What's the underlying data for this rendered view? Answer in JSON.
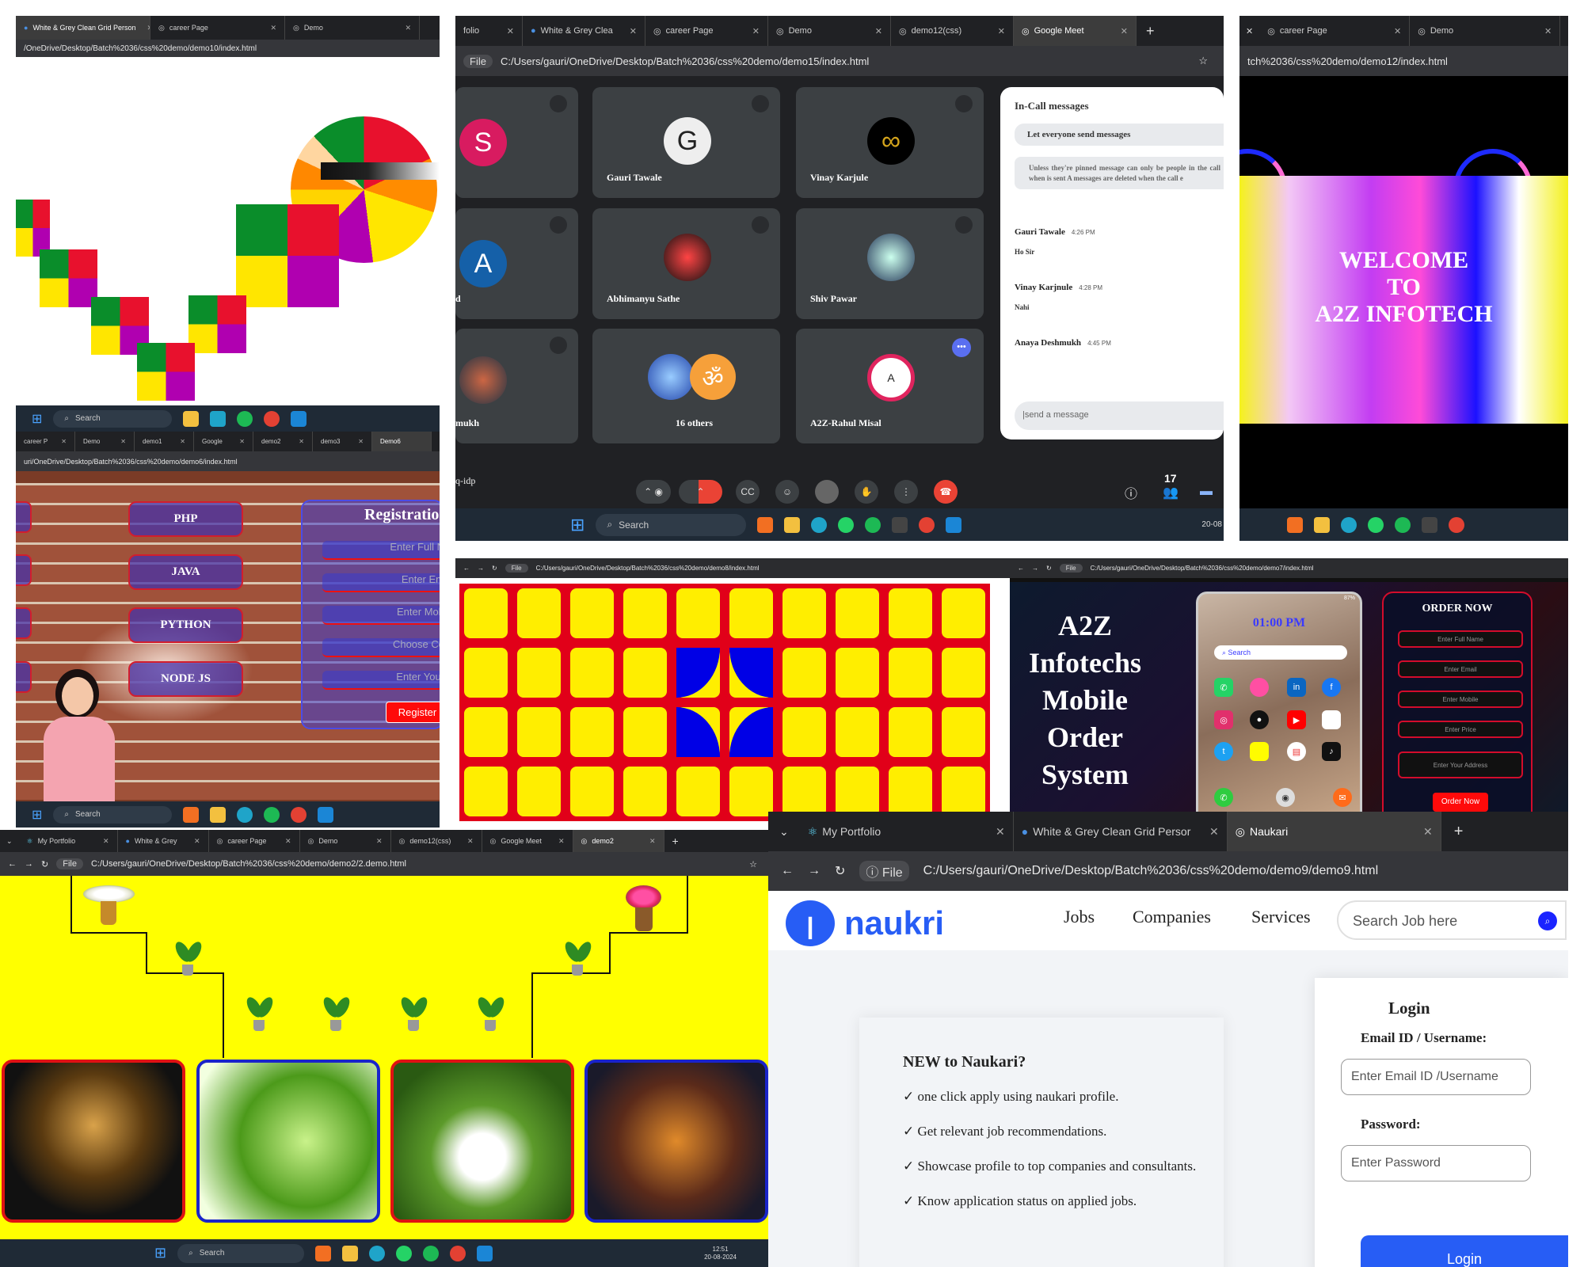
{
  "p1": {
    "tabs": [
      "White & Grey Clean Grid Person",
      "career Page",
      "Demo"
    ],
    "url": "/OneDrive/Desktop/Batch%2036/css%20demo/demo10/index.html",
    "search": "Search"
  },
  "p2": {
    "tabs": [
      "folio",
      "White & Grey Clea",
      "career Page",
      "Demo",
      "demo12(css)",
      "Google Meet"
    ],
    "file": "File",
    "url": "C:/Users/gauri/OneDrive/Desktop/Batch%2036/css%20demo/demo15/index.html",
    "tiles": [
      {
        "letter": "S",
        "name": ""
      },
      {
        "letter": "G",
        "name": "Gauri Tawale"
      },
      {
        "letter": "",
        "name": "Vinay Karjule"
      },
      {
        "letter": "A",
        "name": "d"
      },
      {
        "letter": "",
        "name": "Abhimanyu Sathe"
      },
      {
        "letter": "",
        "name": "Shiv Pawar"
      },
      {
        "letter": "",
        "name": "mukh"
      },
      {
        "letter": "",
        "name": "16 others"
      },
      {
        "letter": "",
        "name": "A2Z-Rahul Misal"
      }
    ],
    "chat": {
      "title": "In-Call messages",
      "toggle": "Let everyone send messages",
      "notice": "Unless they're pinned message can only be people in the call when is sent A messages are deleted when the call e",
      "messages": [
        {
          "name": "Gauri Tawale",
          "time": "4:26 PM",
          "text": "Ho Sir"
        },
        {
          "name": "Vinay Karjnule",
          "time": "4:28 PM",
          "text": "Nahi"
        },
        {
          "name": "Anaya Deshmukh",
          "time": "4:45 PM",
          "text": ""
        }
      ],
      "placeholder": "|send a message"
    },
    "meeting_code": "q-idp",
    "people_count": "17",
    "search": "Search",
    "date": "20-08"
  },
  "p3": {
    "tabs": [
      "career Page",
      "Demo"
    ],
    "url": "tch%2036/css%20demo/demo12/index.html",
    "welcome": [
      "WELCOME",
      "TO",
      "A2Z INFOTECH"
    ]
  },
  "p4": {
    "tabs": [
      "career P",
      "Demo",
      "demo1",
      "Google",
      "demo2",
      "demo3",
      "Demo6"
    ],
    "url": "uri/OneDrive/Desktop/Batch%2036/css%20demo/demo6/index.html",
    "courses": [
      "PHP",
      "JAVA",
      "PYTHON",
      "NODE JS"
    ],
    "reg_title": "Registratio",
    "inputs": [
      "Enter Full N",
      "Enter Em",
      "Enter Mob",
      "Choose Co",
      "Enter Your"
    ],
    "register": "Register",
    "search": "Search"
  },
  "p5": {
    "url": "C:/Users/gauri/OneDrive/Desktop/Batch%2036/css%20demo/demo8/index.html",
    "file": "File",
    "colors": {
      "yellow": "#ffee00",
      "red": "#e10019",
      "blue": "#0000e6"
    }
  },
  "p6": {
    "url": "C:/Users/gauri/OneDrive/Desktop/Batch%2036/css%20demo/demo7/index.html",
    "title": [
      "A2Z",
      "Infotechs",
      "Mobile",
      "Order",
      "System"
    ],
    "phone_time": "01:00 PM",
    "phone_search": "Search",
    "battery": "87%",
    "order_title": "ORDER NOW",
    "order_inputs": [
      "Enter Full Name",
      "Enter Email",
      "Enter Mobile",
      "Enter Price",
      "Enter Your Address"
    ],
    "order_button": "Order Now"
  },
  "p7": {
    "tabs": [
      "My Portfolio",
      "White & Grey",
      "career Page",
      "Demo",
      "demo12(css)",
      "Google Meet",
      "demo2"
    ],
    "file": "File",
    "url": "C:/Users/gauri/OneDrive/Desktop/Batch%2036/css%20demo/demo2/2.demo.html",
    "search": "Search",
    "time": "12:51",
    "date": "20-08-2024"
  },
  "p8": {
    "tabs": [
      "My Portfolio",
      "White & Grey Clean Grid Persor",
      "Naukari"
    ],
    "file": "File",
    "url": "C:/Users/gauri/OneDrive/Desktop/Batch%2036/css%20demo/demo9/demo9.html",
    "logo": "naukri",
    "nav": [
      "Jobs",
      "Companies",
      "Services"
    ],
    "search_placeholder": "Search Job here",
    "new_title": "NEW to Naukari?",
    "benefits": [
      "✓ one click apply using naukari profile.",
      "✓ Get relevant job recommendations.",
      "✓ Showcase profile to top companies and consultants.",
      "✓ Know application status on applied jobs."
    ],
    "login_title": "Login",
    "email_label": "Email ID / Username:",
    "email_placeholder": "Enter Email ID /Username",
    "password_label": "Password:",
    "password_placeholder": "Enter Password",
    "login_button": "Login"
  }
}
